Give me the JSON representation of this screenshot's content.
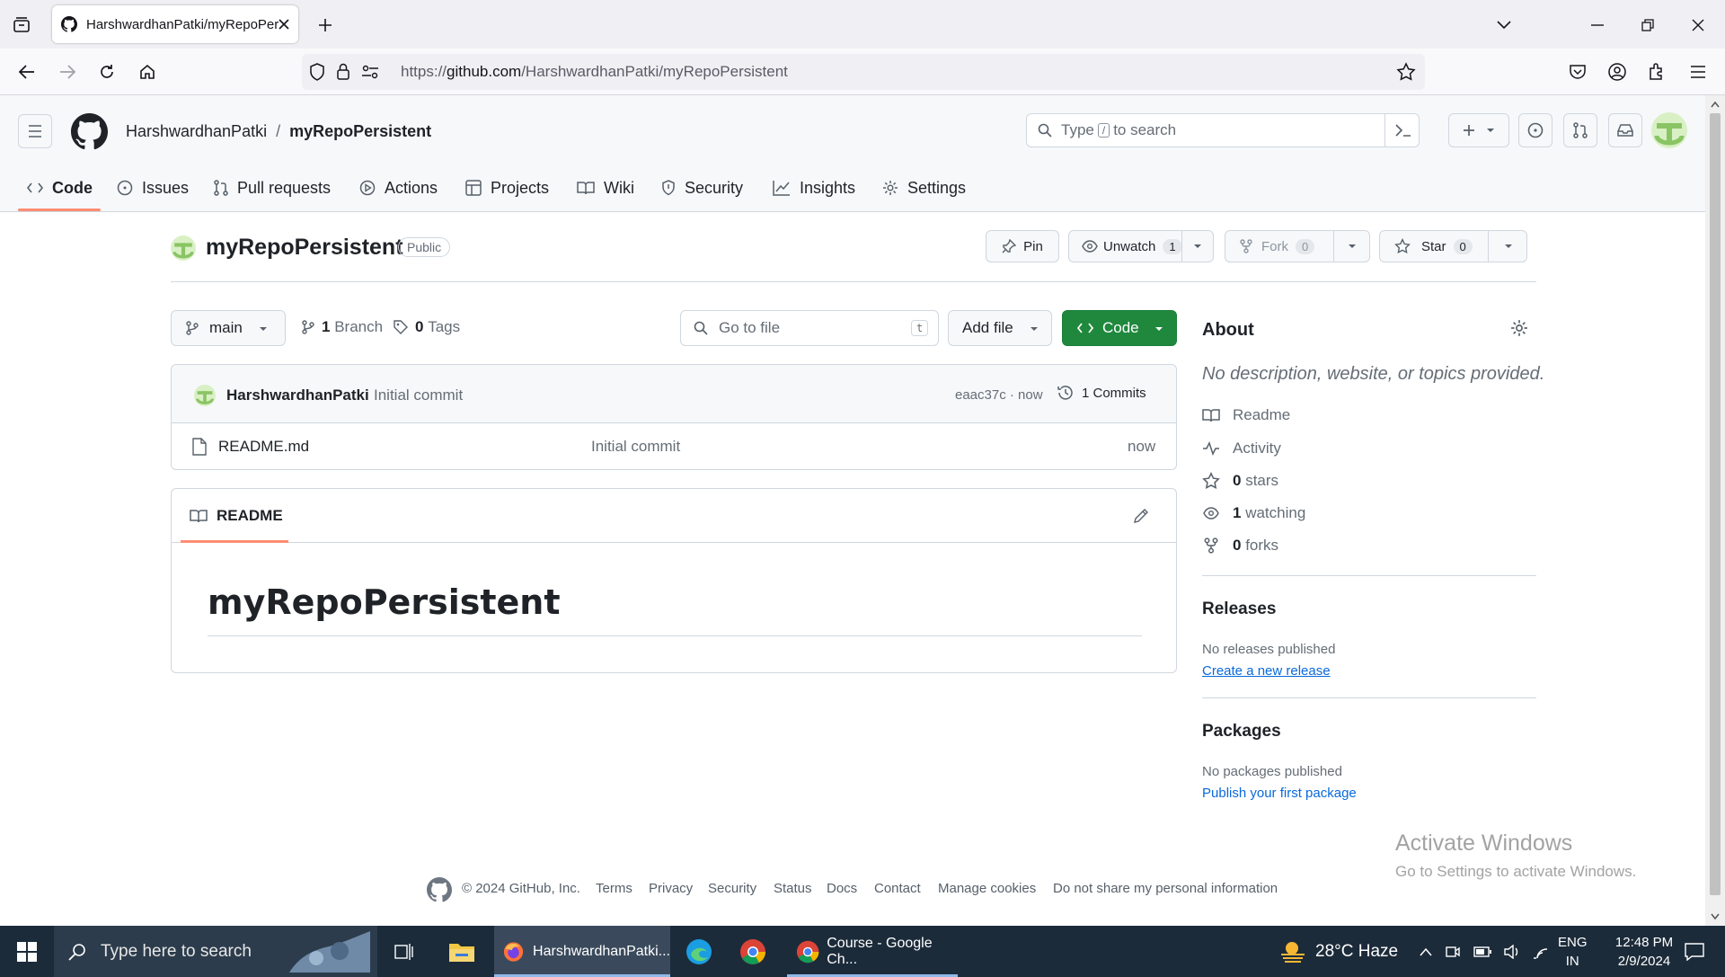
{
  "browser": {
    "tab_title": "HarshwardhanPatki/myRepoPer",
    "url_prefix": "https://",
    "url_host": "github.com",
    "url_path": "/HarshwardhanPatki/myRepoPersistent"
  },
  "header": {
    "owner": "HarshwardhanPatki",
    "separator": "/",
    "repo": "myRepoPersistent",
    "search_placeholder_pre": "Type",
    "search_key": "/",
    "search_placeholder_post": "to search"
  },
  "nav_tabs": [
    {
      "label": "Code",
      "icon": "code-icon"
    },
    {
      "label": "Issues",
      "icon": "issue-icon"
    },
    {
      "label": "Pull requests",
      "icon": "pull-request-icon"
    },
    {
      "label": "Actions",
      "icon": "play-icon"
    },
    {
      "label": "Projects",
      "icon": "table-icon"
    },
    {
      "label": "Wiki",
      "icon": "book-icon"
    },
    {
      "label": "Security",
      "icon": "shield-icon"
    },
    {
      "label": "Insights",
      "icon": "graph-icon"
    },
    {
      "label": "Settings",
      "icon": "gear-icon"
    }
  ],
  "repo": {
    "name": "myRepoPersistent",
    "visibility": "Public",
    "pin_label": "Pin",
    "unwatch_label": "Unwatch",
    "watch_count": "1",
    "fork_label": "Fork",
    "fork_count": "0",
    "star_label": "Star",
    "star_count": "0"
  },
  "toolbar": {
    "branch": "main",
    "branch_count": "1",
    "branch_label": "Branch",
    "tag_count": "0",
    "tag_label": "Tags",
    "goto_placeholder": "Go to file",
    "goto_key": "t",
    "add_file_label": "Add file",
    "code_label": "Code"
  },
  "commit": {
    "author": "HarshwardhanPatki",
    "message": "Initial commit",
    "hash_time": "eaac37c · now",
    "commits_label": "1 Commits"
  },
  "files": [
    {
      "name": "README.md",
      "message": "Initial commit",
      "time": "now"
    }
  ],
  "readme": {
    "tab_label": "README",
    "heading": "myRepoPersistent"
  },
  "about": {
    "title": "About",
    "description": "No description, website, or topics provided.",
    "readme": "Readme",
    "activity": "Activity",
    "stars_count": "0",
    "stars_label": "stars",
    "watching_count": "1",
    "watching_label": "watching",
    "forks_count": "0",
    "forks_label": "forks"
  },
  "releases": {
    "title": "Releases",
    "none": "No releases published",
    "link": "Create a new release"
  },
  "packages": {
    "title": "Packages",
    "none": "No packages published",
    "link": "Publish your first package"
  },
  "watermark": {
    "line1": "Activate Windows",
    "line2": "Go to Settings to activate Windows."
  },
  "footer": {
    "copyright": "© 2024 GitHub, Inc.",
    "links": [
      "Terms",
      "Privacy",
      "Security",
      "Status",
      "Docs",
      "Contact",
      "Manage cookies",
      "Do not share my personal information"
    ]
  },
  "taskbar": {
    "search_placeholder": "Type here to search",
    "firefox_label": "HarshwardhanPatki...",
    "chrome_label": "Course - Google Ch...",
    "weather": "28°C Haze",
    "lang1": "ENG",
    "lang2": "IN",
    "time": "12:48 PM",
    "date": "2/9/2024"
  },
  "colors": {
    "accent_green": "#1f883d",
    "link_blue": "#0969da",
    "active_tab_underline": "#fd8c73"
  }
}
